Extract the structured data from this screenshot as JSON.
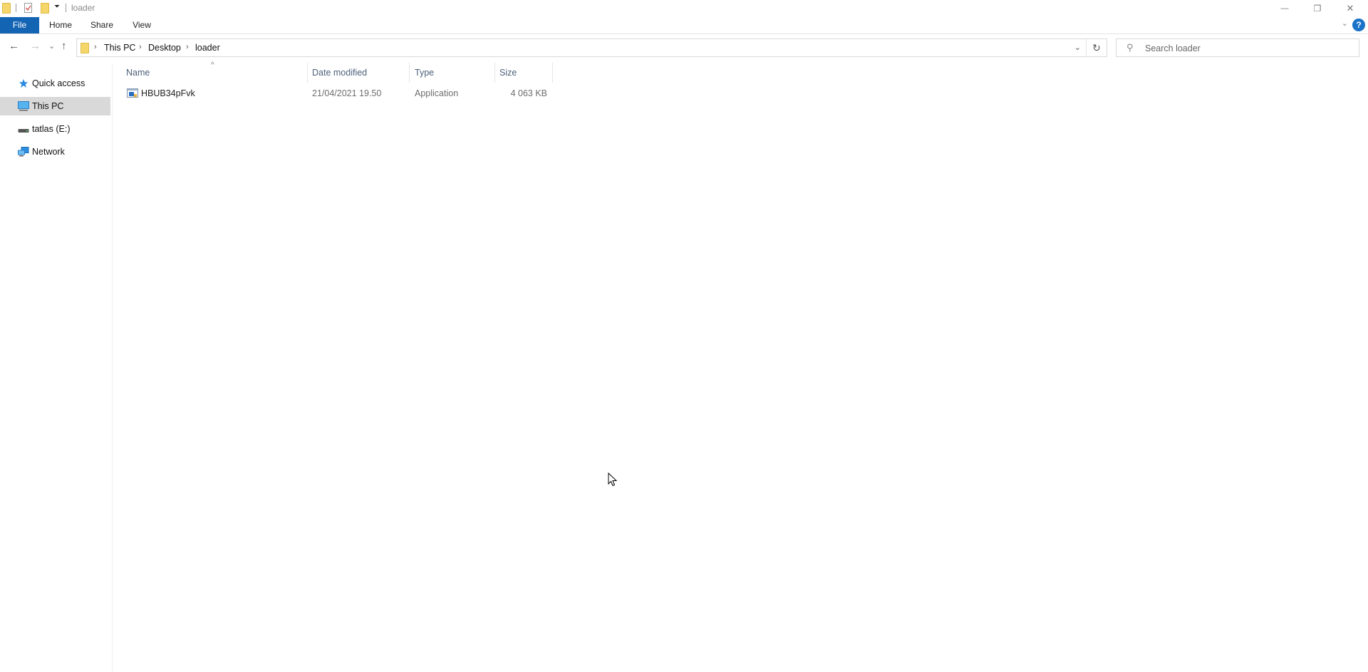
{
  "window": {
    "title": "loader",
    "controls": {
      "minimize": "—",
      "maximize": "❐",
      "close": "✕"
    }
  },
  "quick_access_toolbar": {
    "icons": [
      "folder-icon",
      "properties-icon",
      "new-folder-icon",
      "customize-dropdown-icon"
    ],
    "dropdown_glyph": "⏷"
  },
  "ribbon": {
    "tabs": [
      {
        "label": "File",
        "active": true
      },
      {
        "label": "Home"
      },
      {
        "label": "Share"
      },
      {
        "label": "View"
      }
    ],
    "expand_glyph": "⌄",
    "help_glyph": "?"
  },
  "navigation": {
    "back_glyph": "←",
    "forward_glyph": "→",
    "recent_glyph": "⌄",
    "up_glyph": "↑"
  },
  "address_bar": {
    "breadcrumbs": [
      "This PC",
      "Desktop",
      "loader"
    ],
    "separator": "›",
    "dropdown_glyph": "⌄",
    "refresh_glyph": "↻"
  },
  "search": {
    "placeholder": "Search loader",
    "value": "",
    "icon_glyph": "⚲"
  },
  "sidebar": {
    "items": [
      {
        "label": "Quick access",
        "icon": "star-icon"
      },
      {
        "label": "This PC",
        "icon": "computer-icon",
        "selected": true
      },
      {
        "label": "tatlas (E:)",
        "icon": "drive-icon"
      },
      {
        "label": "Network",
        "icon": "network-icon"
      }
    ]
  },
  "file_list": {
    "columns": [
      "Name",
      "Date modified",
      "Type",
      "Size"
    ],
    "sort_column": "Name",
    "sort_glyph": "^",
    "rows": [
      {
        "name": "HBUB34pFvk",
        "date_modified": "21/04/2021 19.50",
        "type": "Application",
        "size": "4 063 KB"
      }
    ]
  },
  "colors": {
    "accent": "#1464b4",
    "selection": "#d9d9d9",
    "folder": "#f5d66b",
    "column_header_text": "#4c607a"
  }
}
